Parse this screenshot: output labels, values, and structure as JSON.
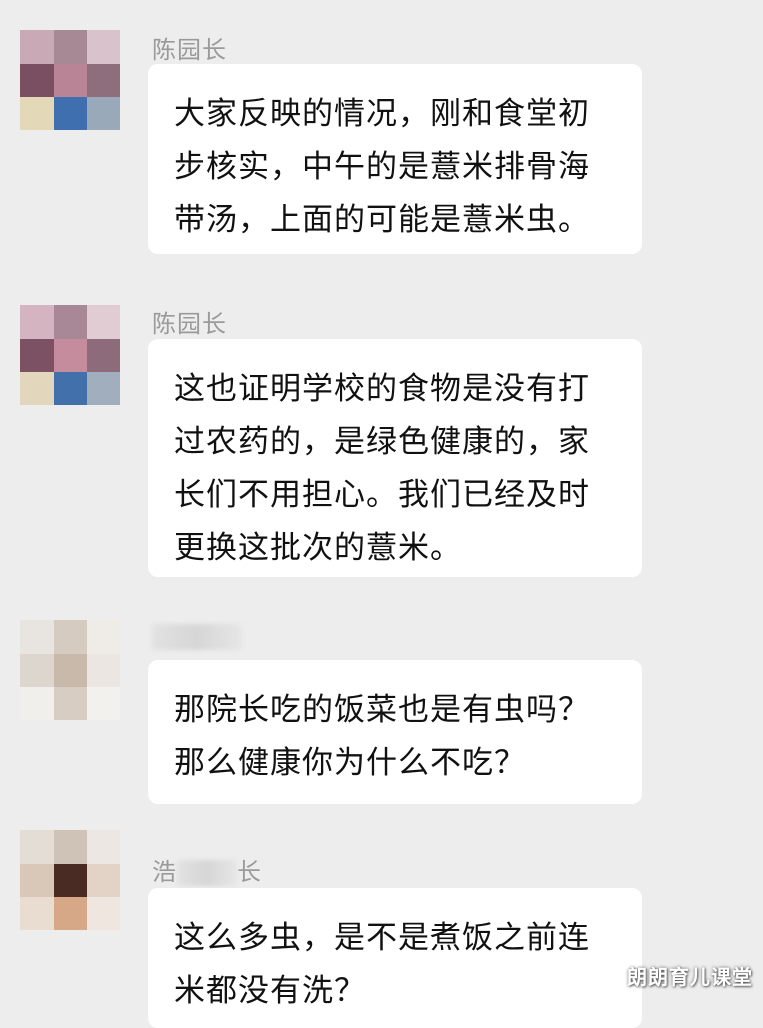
{
  "messages": [
    {
      "sender": "陈园长",
      "text": "大家反映的情况，刚和食堂初\n步核实，中午的是薏米排骨海\n带汤，上面的可能是薏米虫。"
    },
    {
      "sender": "陈园长",
      "text": "这也证明学校的食物是没有打\n过农药的，是绿色健康的，家\n长们不用担心。我们已经及时\n更换这批次的薏米。"
    },
    {
      "sender": "",
      "text": "那院长吃的饭菜也是有虫吗？\n那么健康你为什么不吃？"
    },
    {
      "sender_prefix": "浩",
      "sender_suffix": "长",
      "text": "这么多虫，是不是煮饭之前连\n米都没有洗？"
    }
  ],
  "watermark": "朗朗育儿课堂"
}
